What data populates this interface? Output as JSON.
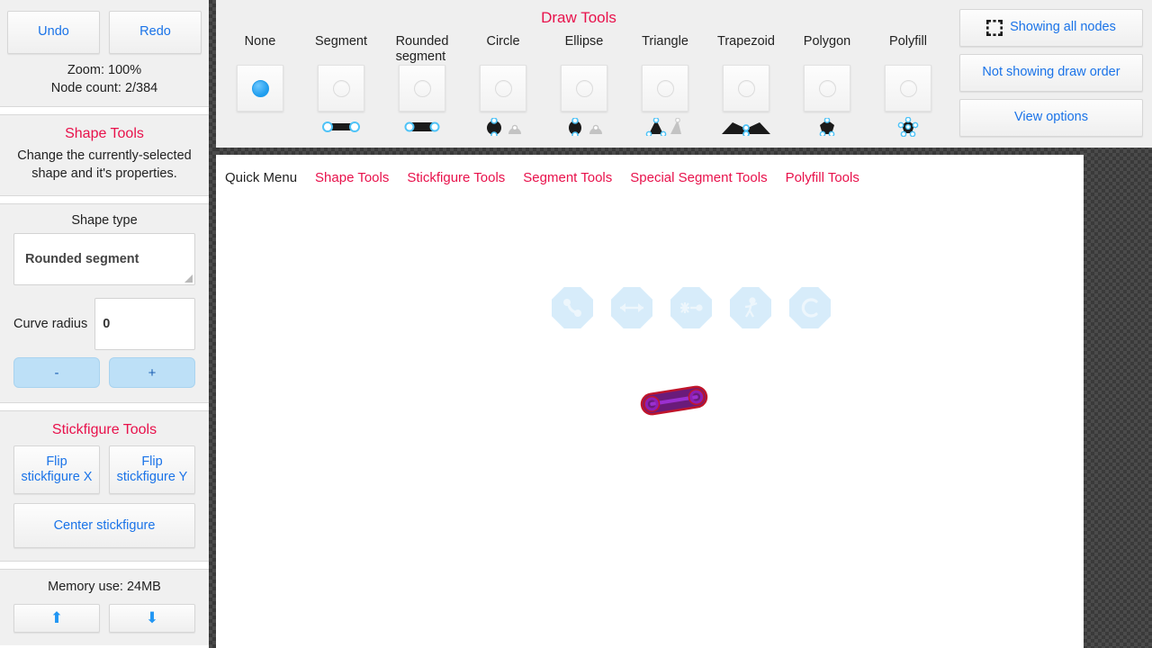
{
  "sidebar": {
    "history": {
      "undo_label": "Undo",
      "redo_label": "Redo"
    },
    "status": {
      "zoom": "Zoom: 100%",
      "node_count": "Node count: 2/384"
    },
    "shape_tools": {
      "title": "Shape Tools",
      "description": "Change the currently-selected shape and it's properties.",
      "shape_type_label": "Shape type",
      "shape_type_value": "Rounded segment",
      "curve_radius_label": "Curve radius",
      "curve_radius_value": "0",
      "minus_label": "-",
      "plus_label": "+"
    },
    "stickfigure_tools": {
      "title": "Stickfigure Tools",
      "flip_x_label": "Flip stickfigure X",
      "flip_y_label": "Flip stickfigure Y",
      "center_label": "Center stickfigure"
    },
    "memory": {
      "label": "Memory use: 24MB",
      "up_icon": "arrow-up-icon",
      "down_icon": "arrow-down-icon",
      "up_glyph": "⬆",
      "down_glyph": "⬇"
    }
  },
  "toolbar": {
    "title": "Draw Tools",
    "tools": [
      {
        "label": "None",
        "label2": "",
        "selected": true,
        "preview": "none"
      },
      {
        "label": "Segment",
        "label2": "",
        "selected": false,
        "preview": "segment"
      },
      {
        "label": "Rounded",
        "label2": "segment",
        "selected": false,
        "preview": "rounded-segment"
      },
      {
        "label": "Circle",
        "label2": "",
        "selected": false,
        "preview": "circle"
      },
      {
        "label": "Ellipse",
        "label2": "",
        "selected": false,
        "preview": "ellipse"
      },
      {
        "label": "Triangle",
        "label2": "",
        "selected": false,
        "preview": "triangle"
      },
      {
        "label": "Trapezoid",
        "label2": "",
        "selected": false,
        "preview": "trapezoid"
      },
      {
        "label": "Polygon",
        "label2": "",
        "selected": false,
        "preview": "polygon"
      },
      {
        "label": "Polyfill",
        "label2": "",
        "selected": false,
        "preview": "polyfill"
      }
    ],
    "view_buttons": [
      {
        "label": "Showing all nodes",
        "icon": "selection-frame-icon"
      },
      {
        "label": "Not showing draw order",
        "icon": ""
      },
      {
        "label": "View options",
        "icon": ""
      }
    ]
  },
  "quick_menu": {
    "static_label": "Quick Menu",
    "links": [
      "Shape Tools",
      "Stickfigure Tools",
      "Segment Tools",
      "Special Segment Tools",
      "Polyfill Tools"
    ]
  },
  "canvas": {
    "octa_buttons": [
      {
        "name": "node-pair-icon"
      },
      {
        "name": "resize-horizontal-icon"
      },
      {
        "name": "node-connect-icon"
      },
      {
        "name": "stickfigure-icon"
      },
      {
        "name": "rotate-icon"
      }
    ],
    "shape": {
      "type": "rounded segment",
      "fill_color": "#7b1fa2",
      "outline_color": "#c0152b",
      "node_color": "#8e1fb5",
      "selected": true
    }
  },
  "colors": {
    "accent_red": "#e8114b",
    "link_blue": "#1a73e8",
    "radio_blue": "#1f9dee",
    "panel_bg": "#f0f0f0",
    "toolbar_bg": "#efefef",
    "canvas_bg": "#ffffff",
    "checker_dark": "#3a3a3a"
  }
}
